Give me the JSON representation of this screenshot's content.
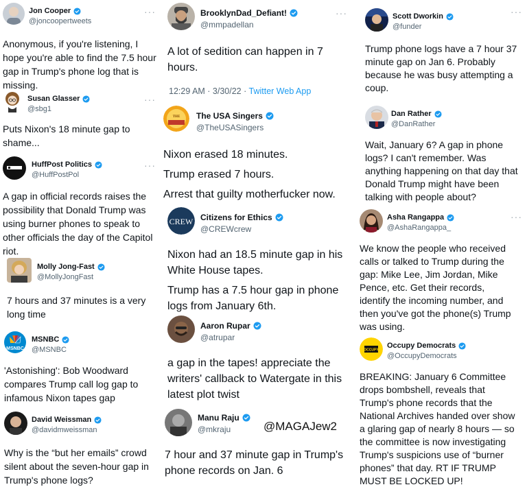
{
  "more_label": "···",
  "watermark": "@MAGAJew2",
  "colors": {
    "verified": "#1d9bf0",
    "handle": "#536471",
    "link": "#1d9bf0"
  },
  "columns": [
    {
      "tweets": [
        {
          "name": "Jon Cooper",
          "handle": "@joncoopertweets",
          "verified": true,
          "lines": [
            "Anonymous, if you're listening, I",
            "hope you're able to find the 7.5 hour",
            "gap in Trump's phone log that is",
            "missing."
          ]
        },
        {
          "name": "Susan Glasser",
          "handle": "@sbg1",
          "verified": true,
          "lines": [
            "Puts Nixon's 18 minute gap to",
            "shame..."
          ]
        },
        {
          "name": "HuffPost Politics",
          "handle": "@HuffPostPol",
          "verified": true,
          "lines": [
            "A gap in official records raises the",
            "possibility that Donald Trump was",
            "using burner phones to speak to",
            "other officials the day of the Capitol",
            "riot."
          ]
        },
        {
          "name": "Molly Jong-Fast",
          "handle": "@MollyJongFast",
          "verified": true,
          "lines": [
            "7 hours and 37 minutes is a very",
            "long time"
          ]
        },
        {
          "name": "MSNBC",
          "handle": "@MSNBC",
          "verified": true,
          "lines": [
            "'Astonishing': Bob Woodward",
            "compares Trump call log gap to",
            "infamous Nixon tapes gap"
          ]
        },
        {
          "name": "David Weissman",
          "handle": "@davidmweissman",
          "verified": true,
          "lines": [
            "Why is the “but her emails” crowd",
            "silent about the seven-hour gap in",
            "Trump's phone logs?"
          ]
        }
      ]
    },
    {
      "tweets": [
        {
          "name": "BrooklynDad_Defiant!",
          "handle": "@mmpadellan",
          "verified": true,
          "lines": [
            "A lot of sedition can happen in 7",
            "hours."
          ],
          "timestamp": "12:29 AM · 3/30/22 · ",
          "app": "Twitter Web App"
        },
        {
          "name": "The USA Singers",
          "handle": "@TheUSASingers",
          "verified": true,
          "lines": [
            "Nixon erased 18 minutes.",
            "Trump erased 7 hours.",
            "Arrest that guilty motherfucker now."
          ]
        },
        {
          "name": "Citizens for Ethics",
          "handle": "@CREWcrew",
          "verified": true,
          "lines": [
            "Nixon had an 18.5 minute gap in his",
            "White House tapes.",
            "Trump has a 7.5 hour gap in phone",
            "logs from January 6th."
          ]
        },
        {
          "name": "Aaron Rupar",
          "handle": "@atrupar",
          "verified": true,
          "lines": [
            "a gap in the tapes! appreciate the",
            "writers' callback to Watergate in this",
            "latest plot twist"
          ]
        },
        {
          "name": "Manu Raju",
          "handle": "@mkraju",
          "verified": true,
          "lines": [
            "7 hour and 37 minute gap in Trump's",
            "phone records on Jan. 6"
          ]
        }
      ]
    },
    {
      "tweets": [
        {
          "name": "Scott Dworkin",
          "handle": "@funder",
          "verified": true,
          "lines": [
            "Trump phone logs have a 7 hour 37",
            "minute gap on Jan 6. Probably",
            "because he was busy attempting a",
            "coup."
          ]
        },
        {
          "name": "Dan Rather",
          "handle": "@DanRather",
          "verified": true,
          "lines": [
            "Wait, January 6? A gap in phone",
            "logs? I can't remember. Was",
            "anything happening on that day that",
            "Donald Trump might have been",
            "talking with people about?"
          ]
        },
        {
          "name": "Asha Rangappa",
          "handle": "@AshaRangappa_",
          "verified": true,
          "lines": [
            "We know the people who received",
            "calls or talked to Trump during the",
            "gap: Mike Lee, Jim Jordan, Mike",
            "Pence, etc. Get their records,",
            "identify the incoming number, and",
            "then you've got the phone(s) Trump",
            "was using."
          ]
        },
        {
          "name": "Occupy Democrats",
          "handle": "@OccupyDemocrats",
          "verified": true,
          "lines": [
            "BREAKING: January 6 Committee",
            "drops bombshell, reveals that",
            "Trump's phone records that the",
            "National Archives handed over show",
            "a glaring gap of nearly 8 hours — so",
            "the committee is now investigating",
            "Trump's suspicions use of “burner",
            "phones” that day. RT IF TRUMP",
            "MUST BE LOCKED UP!"
          ]
        }
      ]
    }
  ]
}
